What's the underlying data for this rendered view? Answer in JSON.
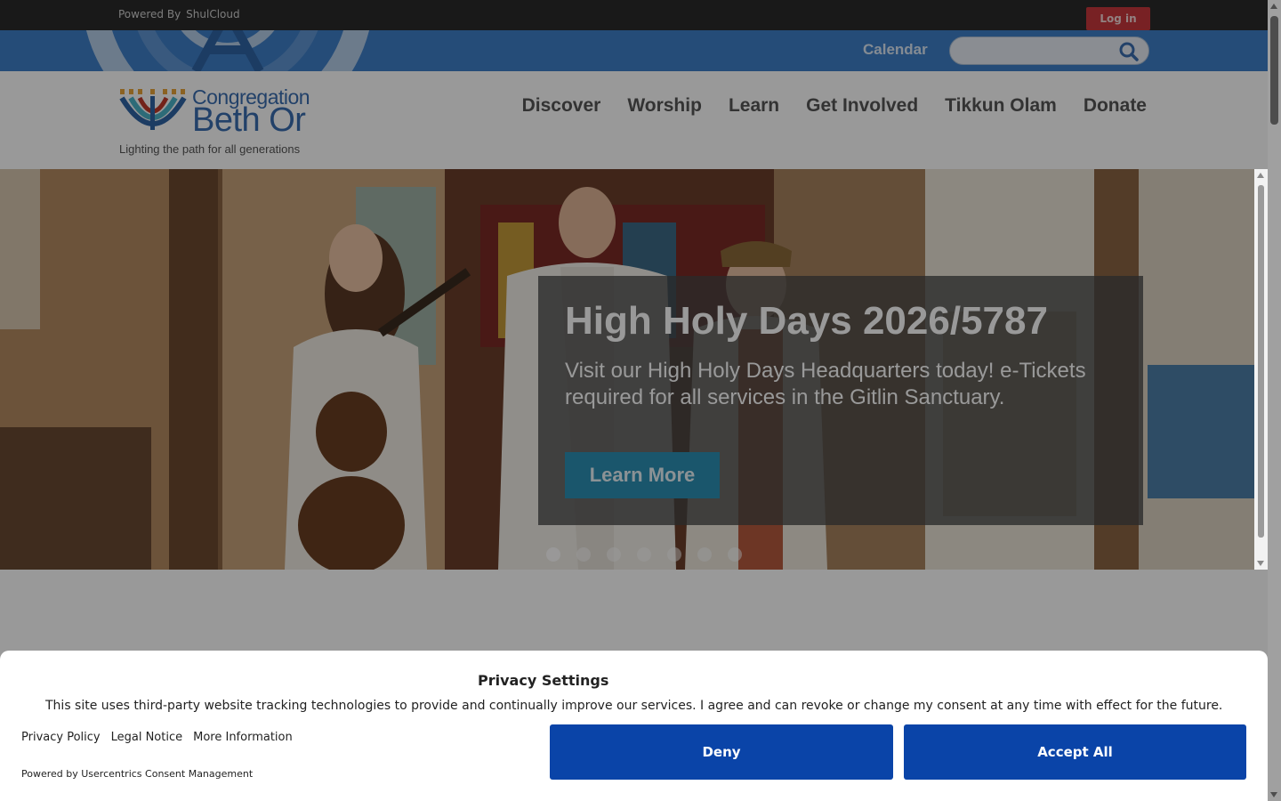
{
  "topbar": {
    "powered_label": "Powered By",
    "powered_brand": "ShulCloud",
    "login_label": "Log in"
  },
  "utility": {
    "calendar_label": "Calendar",
    "search_placeholder": "",
    "search_icon": "search-icon"
  },
  "logo": {
    "line1": "Congregation",
    "line2": "Beth Or",
    "tagline": "Lighting the path for all generations"
  },
  "nav": {
    "items": [
      {
        "label": "Discover"
      },
      {
        "label": "Worship"
      },
      {
        "label": "Learn"
      },
      {
        "label": "Get Involved"
      },
      {
        "label": "Tikkun Olam"
      },
      {
        "label": "Donate"
      }
    ]
  },
  "hero": {
    "title": "High Holy Days 2026/5787",
    "text": "Visit our High Holy Days Headquarters today! e-Tickets required for all services in the Gitlin Sanctuary.",
    "button_label": "Learn More",
    "slide_count": 7,
    "active_slide": 1
  },
  "consent": {
    "title": "Privacy Settings",
    "description": "This site uses third-party website tracking technologies to provide and continually improve our services. I agree and can revoke or change my consent at any time with effect for the future.",
    "links": [
      "Privacy Policy",
      "Legal Notice",
      "More Information"
    ],
    "powered_by": "Powered by Usercentrics Consent Management",
    "deny_label": "Deny",
    "accept_label": "Accept All"
  },
  "colors": {
    "topbar": "#2b2b2b",
    "blue_bar": "#3f7fc8",
    "brand_blue": "#3a6db0",
    "login_red": "#c9383c",
    "learn_more": "#2c8fb4",
    "consent_button": "#0a44a8"
  }
}
